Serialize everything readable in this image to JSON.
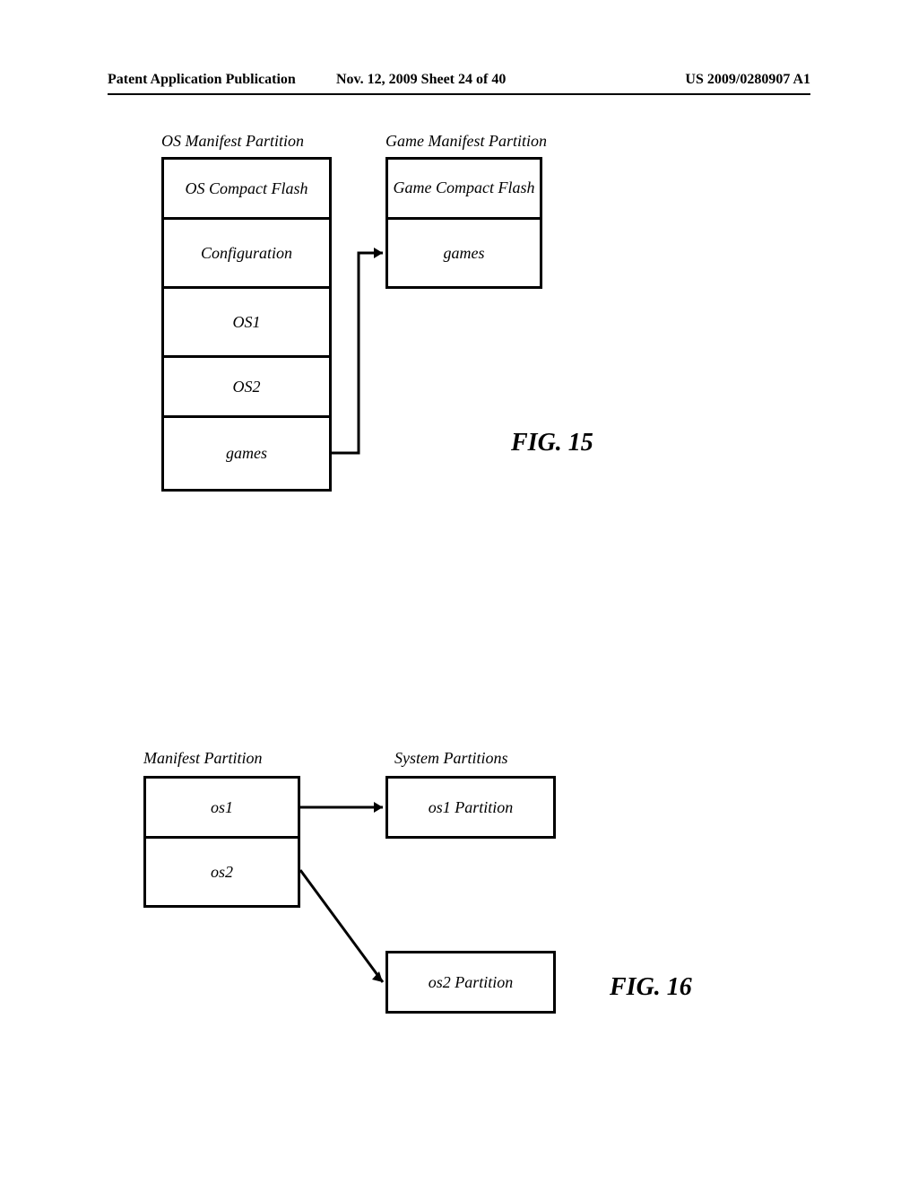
{
  "header": {
    "left": "Patent Application Publication",
    "mid": "Nov. 12, 2009  Sheet 24 of 40",
    "right": "US 2009/0280907 A1"
  },
  "fig15": {
    "title_left": "OS Manifest Partition",
    "title_right": "Game Manifest Partition",
    "os_flash": "OS Compact Flash",
    "config": "Configuration",
    "os1": "OS1",
    "os2": "OS2",
    "games": "games",
    "game_flash": "Game Compact Flash",
    "game_games": "games",
    "figlabel": "FIG. 15"
  },
  "fig16": {
    "title_left": "Manifest Partition",
    "title_right": "System Partitions",
    "os1": "os1",
    "os2": "os2",
    "os1p": "os1 Partition",
    "os2p": "os2 Partition",
    "figlabel": "FIG. 16"
  }
}
